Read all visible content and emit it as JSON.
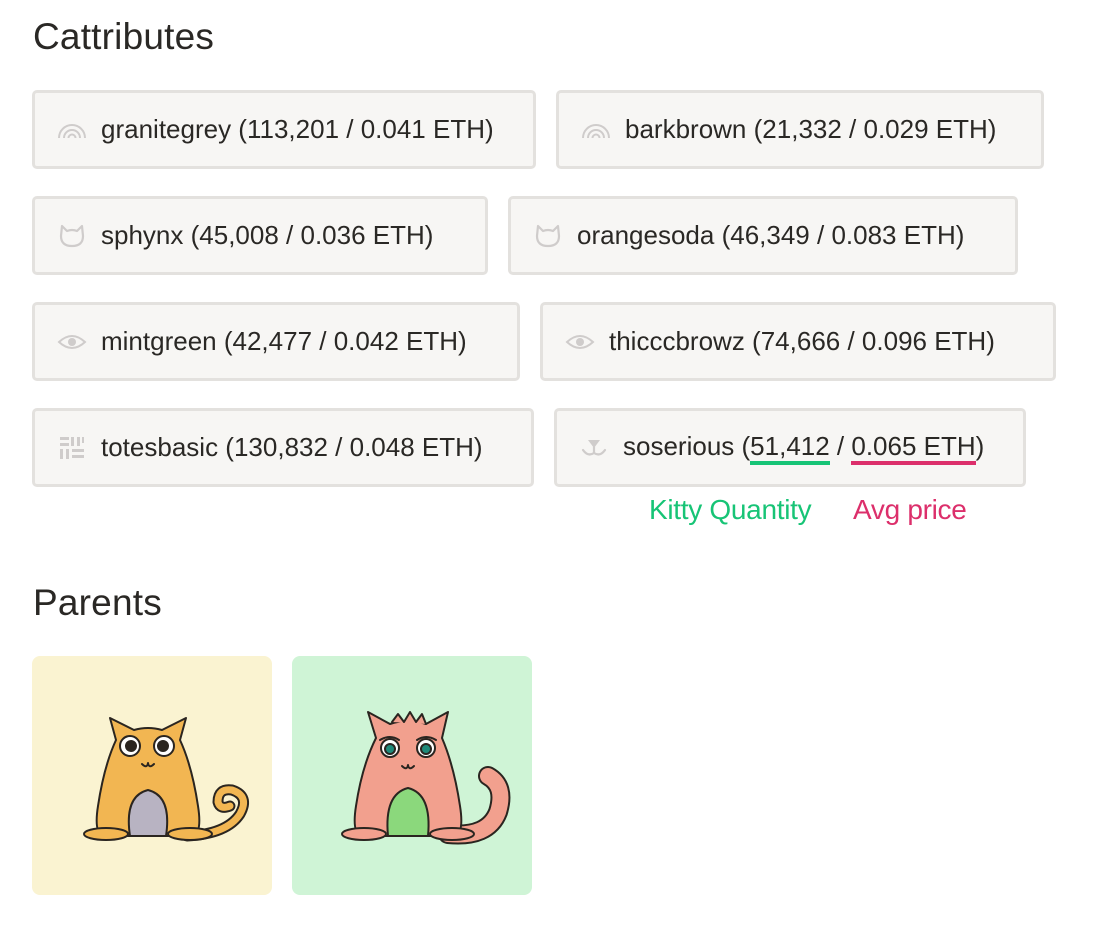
{
  "headings": {
    "cattributes": "Cattributes",
    "parents": "Parents"
  },
  "cattributes": [
    {
      "icon": "rainbow-icon",
      "name": "granitegrey",
      "count": "113,201",
      "price": "0.041 ETH"
    },
    {
      "icon": "rainbow-icon",
      "name": "barkbrown",
      "count": "21,332",
      "price": "0.029 ETH"
    },
    {
      "icon": "cat-head-icon",
      "name": "sphynx",
      "count": "45,008",
      "price": "0.036 ETH"
    },
    {
      "icon": "cat-head-icon",
      "name": "orangesoda",
      "count": "46,349",
      "price": "0.083 ETH"
    },
    {
      "icon": "eye-icon",
      "name": "mintgreen",
      "count": "42,477",
      "price": "0.042 ETH"
    },
    {
      "icon": "eye-icon",
      "name": "thicccbrowz",
      "count": "74,666",
      "price": "0.096 ETH"
    },
    {
      "icon": "pattern-grid-icon",
      "name": "totesbasic",
      "count": "130,832",
      "price": "0.048 ETH"
    },
    {
      "icon": "mouth-icon",
      "name": "soserious",
      "count": "51,412",
      "price": "0.065 ETH"
    }
  ],
  "legend": {
    "quantity": "Kitty Quantity",
    "avg_price": "Avg price"
  },
  "parents": [
    {
      "name": "orange-cat-parent",
      "bg": "#faf3d1",
      "body": "#f2b652",
      "belly": "#b8b3c2"
    },
    {
      "name": "pink-cat-parent",
      "bg": "#cff4d6",
      "body": "#f2a08e",
      "belly": "#8bd87c"
    }
  ],
  "colors": {
    "quantity": "#17c476",
    "avg_price": "#dc2f6b",
    "chip_bg": "#f7f6f4",
    "chip_border": "#e3e1de"
  }
}
